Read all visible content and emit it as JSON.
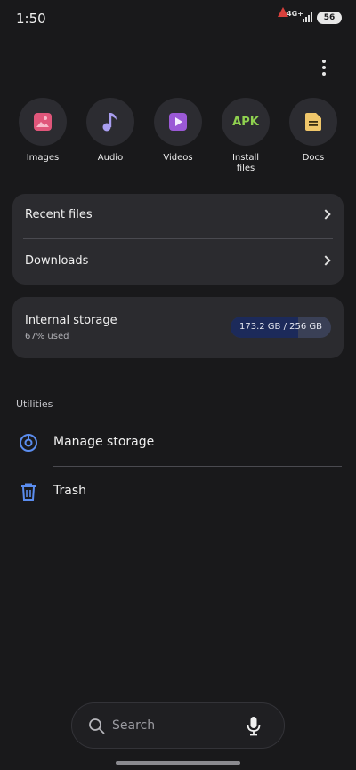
{
  "status_bar": {
    "time": "1:50",
    "network": "4G+",
    "battery": "56"
  },
  "categories": [
    {
      "label": "Images",
      "icon": "image-icon",
      "color": "#e0567a"
    },
    {
      "label": "Audio",
      "icon": "music-note-icon",
      "color": "#a99ef0"
    },
    {
      "label": "Videos",
      "icon": "play-video-icon",
      "color": "#9b59d6"
    },
    {
      "label": "Install files",
      "icon": "apk-icon",
      "icon_text": "APK",
      "color": "#8fd14f"
    },
    {
      "label": "Docs",
      "icon": "document-icon",
      "color": "#efc66a"
    }
  ],
  "quick_links": {
    "recent_files": "Recent files",
    "downloads": "Downloads"
  },
  "storage": {
    "title": "Internal storage",
    "used_text": "67% used",
    "used_fraction": 0.67,
    "usage_text": "173.2 GB  / 256 GB"
  },
  "utilities": {
    "section_title": "Utilities",
    "manage_storage": "Manage storage",
    "trash": "Trash"
  },
  "search": {
    "label": "Search"
  },
  "colors": {
    "background": "#19191b",
    "card": "#2b2b2f",
    "accent_blue": "#5b8def",
    "storage_fill": "#1c2a5a"
  }
}
